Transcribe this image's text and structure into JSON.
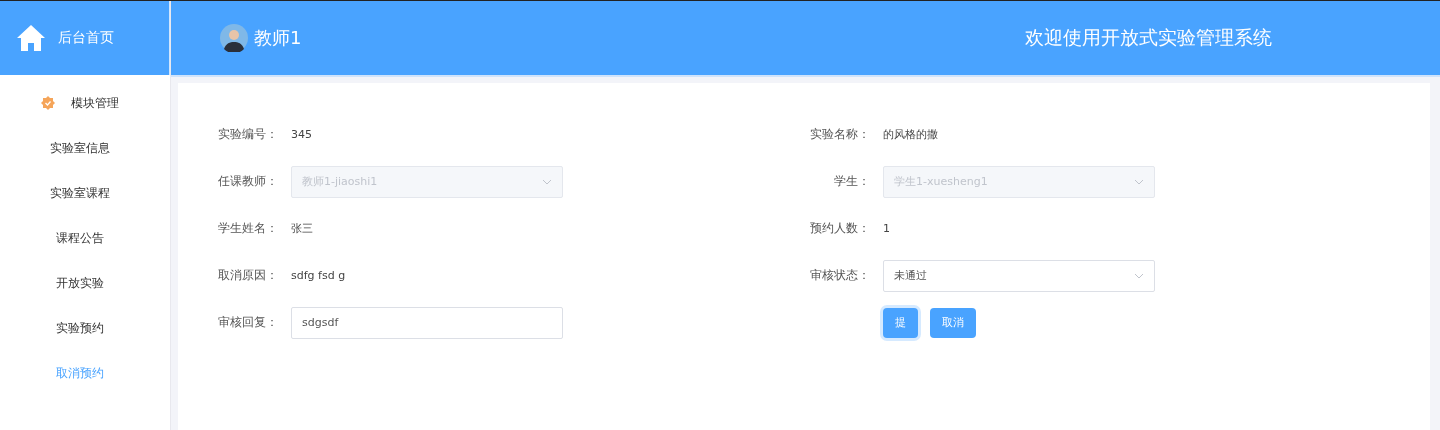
{
  "sidebar": {
    "home_label": "后台首页",
    "group": {
      "label": "模块管理"
    },
    "items": [
      {
        "label": "实验室信息",
        "selected": false
      },
      {
        "label": "实验室课程",
        "selected": false
      },
      {
        "label": "课程公告",
        "selected": false
      },
      {
        "label": "开放实验",
        "selected": false
      },
      {
        "label": "实验预约",
        "selected": false
      },
      {
        "label": "取消预约",
        "selected": true
      }
    ]
  },
  "header": {
    "user_name": "教师1",
    "system_title": "欢迎使用开放式实验管理系统"
  },
  "form": {
    "left": [
      {
        "label": "实验编号：",
        "kind": "text",
        "value": "345"
      },
      {
        "label": "任课教师：",
        "kind": "select",
        "value": "教师1-jiaoshi1",
        "disabled": true
      },
      {
        "label": "学生姓名：",
        "kind": "text",
        "value": "张三"
      },
      {
        "label": "取消原因：",
        "kind": "text",
        "value": "sdfg fsd g"
      },
      {
        "label": "审核回复：",
        "kind": "input",
        "value": "sdgsdf",
        "disabled": false
      }
    ],
    "right": [
      {
        "label": "实验名称：",
        "kind": "text",
        "value": "的风格的撒"
      },
      {
        "label": "学生：",
        "kind": "select",
        "value": "学生1-xuesheng1",
        "disabled": true
      },
      {
        "label": "预约人数：",
        "kind": "text",
        "value": "1"
      },
      {
        "label": "审核状态：",
        "kind": "select",
        "value": "未通过",
        "disabled": false
      }
    ],
    "buttons": [
      {
        "label": "提",
        "kind": "primary",
        "hovered": true
      },
      {
        "label": "取消",
        "kind": "primary",
        "hovered": false
      }
    ]
  }
}
